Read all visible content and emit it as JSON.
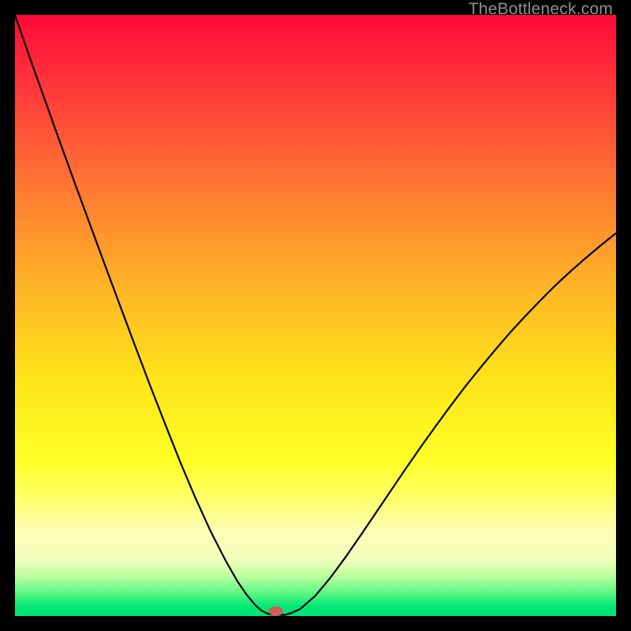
{
  "watermark": "TheBottleneck.com",
  "chart_data": {
    "type": "line",
    "title": "",
    "xlabel": "",
    "ylabel": "",
    "xlim": [
      0,
      100
    ],
    "ylim": [
      0,
      100
    ],
    "grid": false,
    "background": {
      "type": "vertical-gradient",
      "stops": [
        {
          "pos": 0.0,
          "color": "#ff0a3a"
        },
        {
          "pos": 0.1,
          "color": "#ff2f3a"
        },
        {
          "pos": 0.25,
          "color": "#ff6a34"
        },
        {
          "pos": 0.45,
          "color": "#ffb427"
        },
        {
          "pos": 0.6,
          "color": "#ffe21a"
        },
        {
          "pos": 0.74,
          "color": "#ffff26"
        },
        {
          "pos": 0.8,
          "color": "#ffff63"
        },
        {
          "pos": 0.86,
          "color": "#ffffb9"
        },
        {
          "pos": 0.905,
          "color": "#f2ffbc"
        },
        {
          "pos": 0.935,
          "color": "#b9ff9e"
        },
        {
          "pos": 0.96,
          "color": "#62f785"
        },
        {
          "pos": 0.985,
          "color": "#00e676"
        },
        {
          "pos": 1.0,
          "color": "#00e676"
        }
      ]
    },
    "series": [
      {
        "name": "bottleneck-curve",
        "color": "#000000",
        "x": [
          0.0,
          2.5,
          5.0,
          7.5,
          10.0,
          12.5,
          15.0,
          17.5,
          20.0,
          22.5,
          25.0,
          27.5,
          30.0,
          32.5,
          35.0,
          37.0,
          38.5,
          40.0,
          41.0,
          42.0,
          43.0,
          45.0,
          46.0,
          47.5,
          50.0,
          52.5,
          55.0,
          57.5,
          60.0,
          62.5,
          65.0,
          67.5,
          70.0,
          72.5,
          75.0,
          77.5,
          80.0,
          82.5,
          85.0,
          87.5,
          90.0,
          92.5,
          95.0,
          97.5,
          100.0
        ],
        "y": [
          100.0,
          92.8,
          85.8,
          78.8,
          71.9,
          65.1,
          58.3,
          51.6,
          44.9,
          38.3,
          31.9,
          25.6,
          19.7,
          14.2,
          9.3,
          5.8,
          3.6,
          1.8,
          0.9,
          0.4,
          0.2,
          0.2,
          0.5,
          1.2,
          3.4,
          6.4,
          9.8,
          13.4,
          17.1,
          20.8,
          24.5,
          28.1,
          31.6,
          35.0,
          38.3,
          41.4,
          44.4,
          47.3,
          50.0,
          52.6,
          55.1,
          57.4,
          59.6,
          61.7,
          63.7
        ]
      }
    ],
    "marker": {
      "name": "target-point",
      "x": 43.4,
      "y": 0.8,
      "color": "#d55b5b",
      "rx": 1.2,
      "ry": 0.8
    }
  }
}
